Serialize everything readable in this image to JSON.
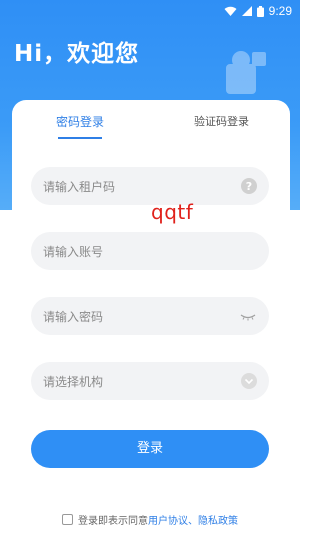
{
  "status_bar": {
    "time": "9:29",
    "icons": [
      "wifi-icon",
      "signal-icon",
      "battery-icon"
    ]
  },
  "header": {
    "greeting": "Hi，欢迎您"
  },
  "tabs": [
    {
      "label": "密码登录",
      "active": true
    },
    {
      "label": "验证码登录",
      "active": false
    }
  ],
  "form": {
    "tenant_placeholder": "请输入租户码",
    "account_placeholder": "请输入账号",
    "password_placeholder": "请输入密码",
    "org_placeholder": "请选择机构",
    "login_label": "登录"
  },
  "agreement": {
    "prefix": "登录即表示同意",
    "links": "用户协议、隐私政策"
  },
  "overlay": {
    "watermark": "qqtf"
  },
  "colors": {
    "primary": "#2f8ff5",
    "link": "#2f7fe6",
    "field_bg": "#f2f3f5",
    "watermark": "#e0211b"
  }
}
